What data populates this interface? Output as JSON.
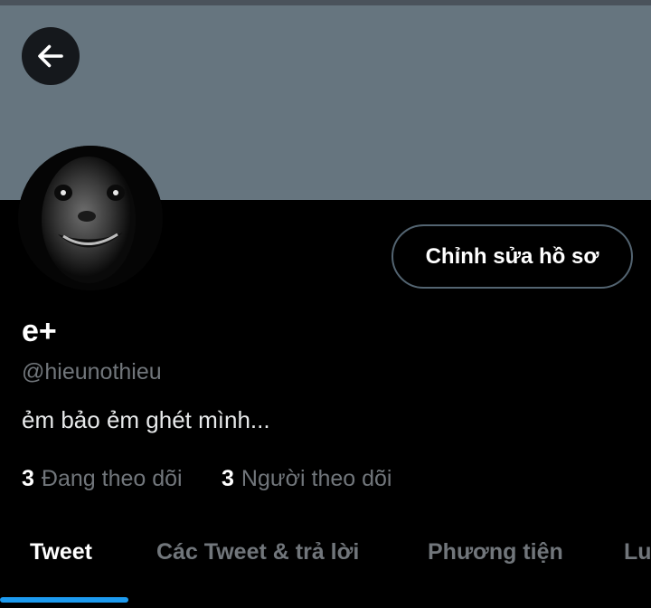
{
  "header": {
    "back_icon": "arrow-left-icon",
    "banner_color": "#66757f"
  },
  "profile": {
    "display_name": "e+",
    "handle": "@hieunothieu",
    "bio": "ẻm bảo ẻm ghét mình...",
    "edit_button_label": "Chỉnh sửa hồ sơ",
    "following_count": "3",
    "following_label": "Đang theo dõi",
    "followers_count": "3",
    "followers_label": "Người theo dõi"
  },
  "tabs": [
    {
      "label": "Tweet",
      "active": true
    },
    {
      "label": "Các Tweet & trả lời",
      "active": false
    },
    {
      "label": "Phương tiện",
      "active": false
    },
    {
      "label": "Lu",
      "active": false
    }
  ],
  "colors": {
    "accent": "#1d9bf0",
    "muted_text": "#71767b",
    "background": "#000000"
  }
}
